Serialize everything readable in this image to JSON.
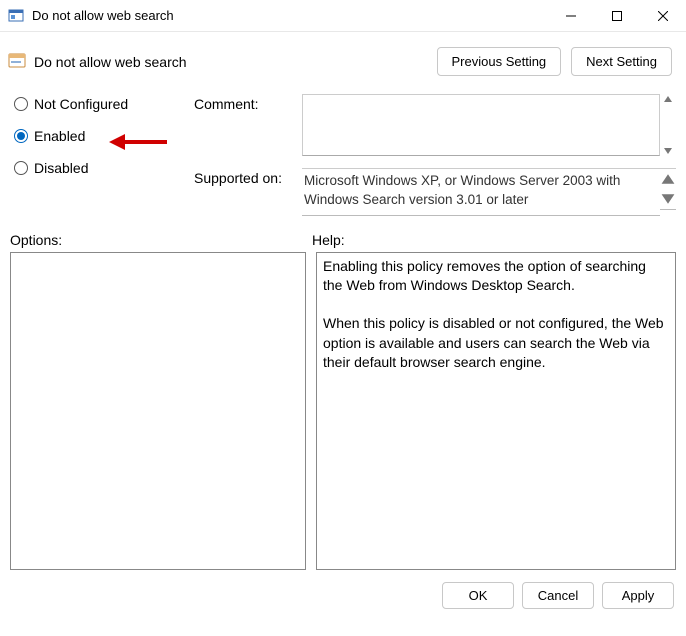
{
  "window": {
    "title": "Do not allow web search",
    "subtitle": "Do not allow web search"
  },
  "nav": {
    "prev": "Previous Setting",
    "next": "Next Setting"
  },
  "radios": {
    "not_configured": "Not Configured",
    "enabled": "Enabled",
    "disabled": "Disabled",
    "selected": "enabled"
  },
  "fields": {
    "comment_label": "Comment:",
    "supported_label": "Supported on:",
    "supported_text": "Microsoft Windows XP, or Windows Server 2003 with Windows Search version 3.01 or later"
  },
  "sections": {
    "options": "Options:",
    "help": "Help:"
  },
  "help": {
    "p1": "Enabling this policy removes the option of searching the Web from Windows Desktop Search.",
    "p2": "When this policy is disabled or not configured, the Web option is available and users can search the Web via their default browser search engine."
  },
  "footer": {
    "ok": "OK",
    "cancel": "Cancel",
    "apply": "Apply"
  }
}
